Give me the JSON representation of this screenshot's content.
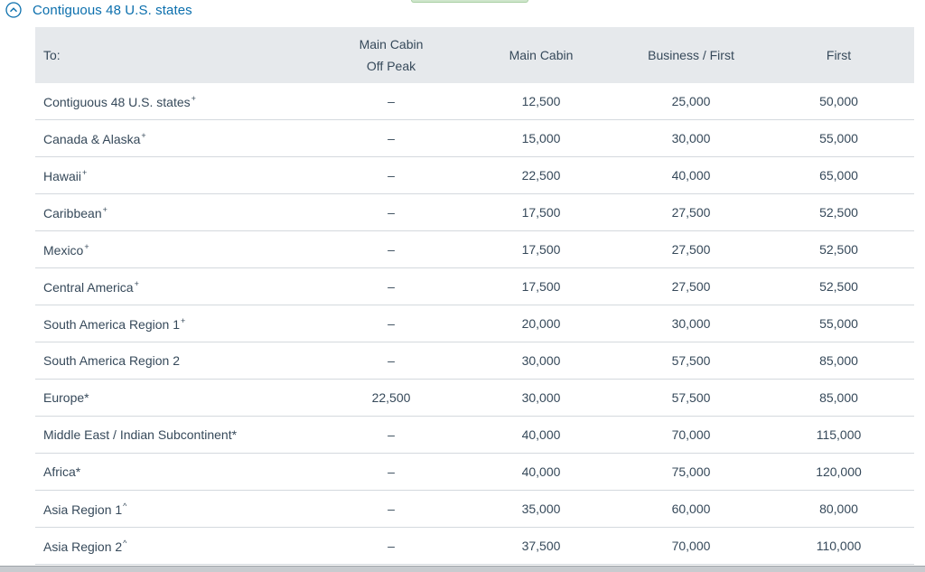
{
  "accordion": {
    "title": "Contiguous 48 U.S. states",
    "icon": "chevron-up-circle-icon",
    "accent_color": "#0b6fad"
  },
  "table": {
    "headers": {
      "to": "To:",
      "main_off_peak_line1": "Main Cabin",
      "main_off_peak_line2": "Off Peak",
      "main_cabin": "Main Cabin",
      "business_first": "Business / First",
      "first": "First"
    },
    "rows": [
      {
        "dest": "Contiguous 48 U.S. states",
        "mark": "+",
        "off_peak": "–",
        "main": "12,500",
        "business": "25,000",
        "first": "50,000"
      },
      {
        "dest": "Canada & Alaska",
        "mark": "+",
        "off_peak": "–",
        "main": "15,000",
        "business": "30,000",
        "first": "55,000"
      },
      {
        "dest": "Hawaii",
        "mark": "+",
        "off_peak": "–",
        "main": "22,500",
        "business": "40,000",
        "first": "65,000"
      },
      {
        "dest": "Caribbean",
        "mark": "+",
        "off_peak": "–",
        "main": "17,500",
        "business": "27,500",
        "first": "52,500"
      },
      {
        "dest": "Mexico",
        "mark": "+",
        "off_peak": "–",
        "main": "17,500",
        "business": "27,500",
        "first": "52,500"
      },
      {
        "dest": "Central America",
        "mark": "+",
        "off_peak": "–",
        "main": "17,500",
        "business": "27,500",
        "first": "52,500"
      },
      {
        "dest": "South America Region 1",
        "mark": "+",
        "off_peak": "–",
        "main": "20,000",
        "business": "30,000",
        "first": "55,000"
      },
      {
        "dest": "South America Region 2",
        "mark": "",
        "off_peak": "–",
        "main": "30,000",
        "business": "57,500",
        "first": "85,000"
      },
      {
        "dest": "Europe*",
        "mark": "",
        "off_peak": "22,500",
        "main": "30,000",
        "business": "57,500",
        "first": "85,000"
      },
      {
        "dest": "Middle East / Indian Subcontinent*",
        "mark": "",
        "off_peak": "–",
        "main": "40,000",
        "business": "70,000",
        "first": "115,000"
      },
      {
        "dest": "Africa*",
        "mark": "",
        "off_peak": "–",
        "main": "40,000",
        "business": "75,000",
        "first": "120,000"
      },
      {
        "dest": "Asia Region 1",
        "mark": "^",
        "off_peak": "–",
        "main": "35,000",
        "business": "60,000",
        "first": "80,000"
      },
      {
        "dest": "Asia Region 2",
        "mark": "^",
        "off_peak": "–",
        "main": "37,500",
        "business": "70,000",
        "first": "110,000"
      }
    ]
  }
}
